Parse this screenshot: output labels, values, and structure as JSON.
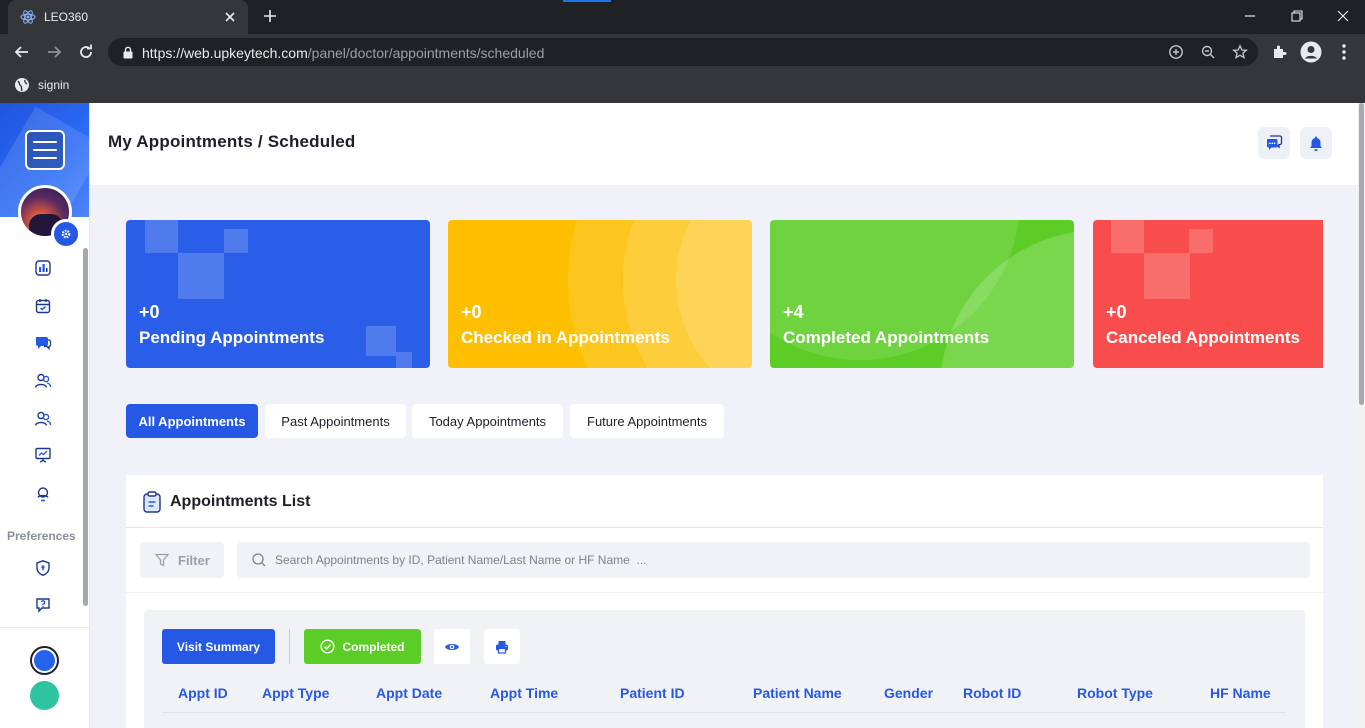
{
  "browser": {
    "tab_title": "LEO360",
    "url_host": "https://web.upkeytech.com",
    "url_path": "/panel/doctor/appointments/scheduled",
    "bookmark": "signin"
  },
  "header": {
    "title": "My Appointments / Scheduled"
  },
  "sidebar": {
    "preferences_label": "Preferences",
    "icons": [
      "dashboard-icon",
      "calendar-icon",
      "chat-icon",
      "users-icon",
      "users-alt-icon",
      "presentation-icon",
      "support-icon",
      "shield-icon",
      "help-icon"
    ],
    "theme_colors": [
      "#2563eb",
      "#2ec4a0"
    ]
  },
  "cards": [
    {
      "count": "+0",
      "label": "Pending Appointments",
      "color": "#2a5ee8"
    },
    {
      "count": "+0",
      "label": "Checked in Appointments",
      "color": "#fdbf00"
    },
    {
      "count": "+4",
      "label": "Completed Appointments",
      "color": "#5ccd26"
    },
    {
      "count": "+0",
      "label": "Canceled Appointments",
      "color": "#f94d4d"
    }
  ],
  "filter_tabs": [
    "All Appointments",
    "Past Appointments",
    "Today Appointments",
    "Future Appointments"
  ],
  "list": {
    "title": "Appointments List",
    "filter_label": "Filter",
    "search_placeholder": "Search Appointments by ID, Patient Name/Last Name or HF Name  ...",
    "visit_summary_label": "Visit Summary",
    "completed_label": "Completed",
    "columns": [
      "Appt ID",
      "Appt Type",
      "Appt Date",
      "Appt Time",
      "Patient ID",
      "Patient Name",
      "Gender",
      "Robot ID",
      "Robot Type",
      "HF Name"
    ]
  }
}
